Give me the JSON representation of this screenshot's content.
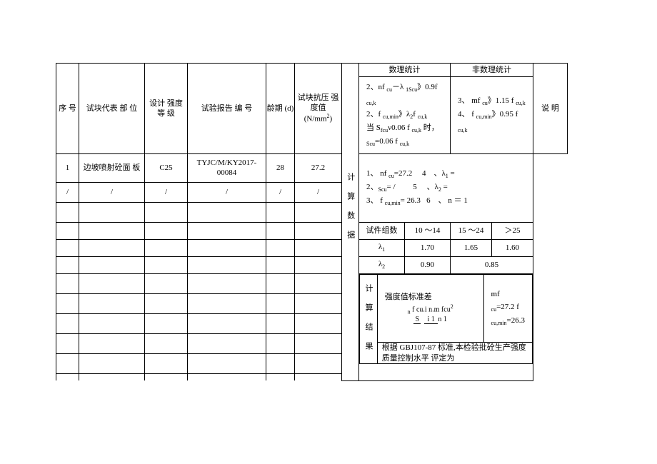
{
  "header": {
    "col_seq": "序 号",
    "col_part": "试块代表 部 位",
    "col_design": "设计 强度 等\n级",
    "col_report": "试验报告 编 号",
    "col_age": "龄期\n(d)",
    "col_strength_a": "试块抗压 强",
    "col_strength_b": "度值",
    "col_strength_c": "(N/mm",
    "col_strength_d": ")",
    "col_mathstat": "数理统计",
    "col_nonstat": "非数理统计",
    "col_note": "说 明",
    "math_line1a": "2、nf ",
    "math_line1b": "－λ ",
    "math_line1c": "》0.9f ",
    "math_line2a": "2、f ",
    "math_line2b": "》λ",
    "math_line2c": "f ",
    "math_line3a": "当 S",
    "math_line3b": "ν0.06 f ",
    "math_line3c": " 时，",
    "math_line3d": "=0.06 f ",
    "non_line1a": "3、 mf ",
    "non_line1b": "》1.15 f ",
    "non_line2a": "4、 f ",
    "non_line2b": "》0.95 f "
  },
  "rows": [
    {
      "seq": "1",
      "part": "边坡喷射砼面 板",
      "design": "C25",
      "report": "TYJC/M/KY2017-00084",
      "age": "28",
      "strength": "27.2"
    },
    {
      "seq": "/",
      "part": "/",
      "design": "/",
      "report": "/",
      "age": "/",
      "strength": "/"
    }
  ],
  "calc_label": "计 算 数 据",
  "calc_lines": {
    "l1a": "1、 nf ",
    "l1b": "=27.2",
    "l1c": "4",
    "l1d": "、λ",
    "l2a": "2、",
    "l2b": "= /",
    "l2c": "5",
    "l2d": "、λ",
    "l3a": "3、 f ",
    "l3b": "= 26.3",
    "l3c": "6",
    "l3d": "、 n ＝ 1"
  },
  "coef": {
    "h1": "试件组数",
    "h2": "10 ～14",
    "h3": "15 ～24",
    "h4": "＞25",
    "r1l": "λ",
    "r1a": "1.70",
    "r1b": "1.65",
    "r1c": "1.60",
    "r2l": "λ",
    "r2a": "0.90",
    "r2b": "0.85"
  },
  "result_label": "计 算 结 果",
  "result": {
    "left_a": "强度值标准差",
    "left_b": "f cu.i n.m fcu",
    "left_c": "n 1",
    "right_a": "mf ",
    "right_b": "=27.2 f ",
    "right_c": "=26.3"
  },
  "footer": "根据 GBJ107-87 标准,本检验批砼生产强度质量控制水平 评定为",
  "sub": {
    "cu": "cu",
    "cuk": "cu,k",
    "cumin": "cu,min",
    "fcu": "fcu",
    "scu": "Scu",
    "fcuV": "fcu"
  }
}
